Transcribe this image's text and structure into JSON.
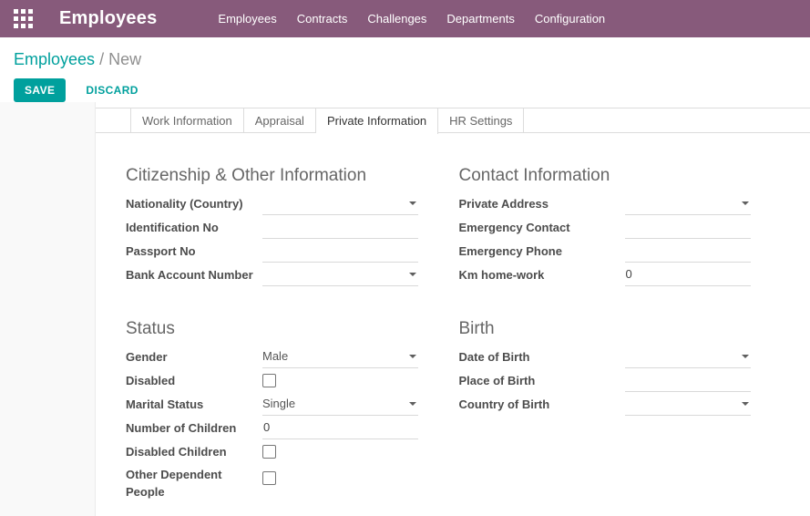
{
  "navbar": {
    "app_icon": "apps-grid-icon",
    "app_title": "Employees",
    "menu_items": [
      "Employees",
      "Contracts",
      "Challenges",
      "Departments",
      "Configuration"
    ]
  },
  "control_panel": {
    "breadcrumb": {
      "parent": "Employees",
      "separator": "/",
      "current": "New"
    },
    "save_label": "SAVE",
    "discard_label": "DISCARD"
  },
  "tabs": {
    "items": [
      "Work Information",
      "Appraisal",
      "Private Information",
      "HR Settings"
    ],
    "active": "Private Information"
  },
  "form": {
    "citizenship": {
      "title": "Citizenship & Other Information",
      "fields": {
        "nationality": {
          "label": "Nationality (Country)",
          "value": "",
          "type": "select"
        },
        "identification_no": {
          "label": "Identification No",
          "value": "",
          "type": "text"
        },
        "passport_no": {
          "label": "Passport No",
          "value": "",
          "type": "text"
        },
        "bank_account": {
          "label": "Bank Account Number",
          "value": "",
          "type": "select"
        }
      }
    },
    "contact": {
      "title": "Contact Information",
      "fields": {
        "private_address": {
          "label": "Private Address",
          "value": "",
          "type": "select"
        },
        "emergency_contact": {
          "label": "Emergency Contact",
          "value": "",
          "type": "text"
        },
        "emergency_phone": {
          "label": "Emergency Phone",
          "value": "",
          "type": "text"
        },
        "km_home_work": {
          "label": "Km home-work",
          "value": "0",
          "type": "text"
        }
      }
    },
    "status": {
      "title": "Status",
      "fields": {
        "gender": {
          "label": "Gender",
          "value": "Male",
          "type": "select"
        },
        "disabled": {
          "label": "Disabled",
          "checked": false,
          "type": "checkbox"
        },
        "marital_status": {
          "label": "Marital Status",
          "value": "Single",
          "type": "select"
        },
        "number_of_children": {
          "label": "Number of Children",
          "value": "0",
          "type": "text"
        },
        "disabled_children": {
          "label": "Disabled Children",
          "checked": false,
          "type": "checkbox"
        },
        "other_dependent_people": {
          "label": "Other Dependent People",
          "checked": false,
          "type": "checkbox"
        }
      }
    },
    "birth": {
      "title": "Birth",
      "fields": {
        "date_of_birth": {
          "label": "Date of Birth",
          "value": "",
          "type": "select"
        },
        "place_of_birth": {
          "label": "Place of Birth",
          "value": "",
          "type": "text"
        },
        "country_of_birth": {
          "label": "Country of Birth",
          "value": "",
          "type": "select"
        }
      }
    }
  },
  "colors": {
    "navbar_bg": "#875A7B",
    "accent_teal": "#00A09D",
    "left_gutter_bg": "#f9f9f9"
  }
}
